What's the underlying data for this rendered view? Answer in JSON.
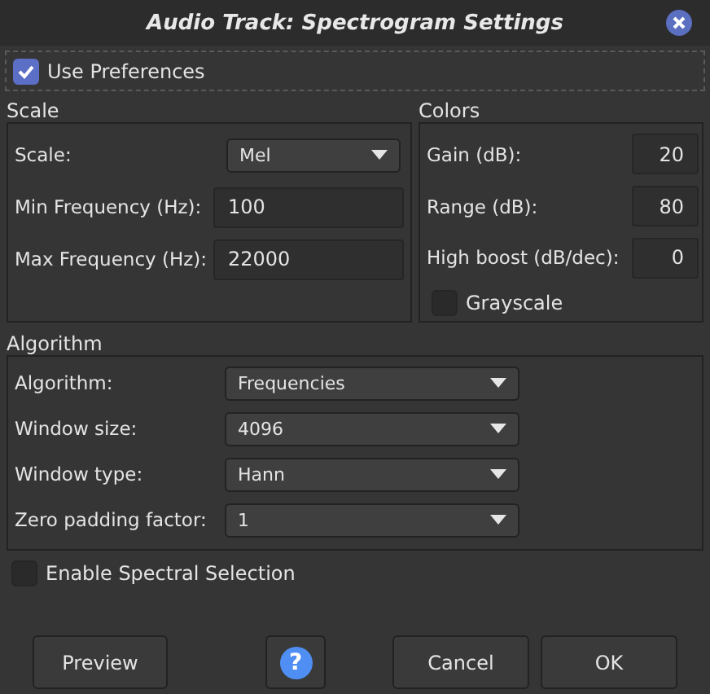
{
  "window": {
    "title": "Audio Track: Spectrogram Settings"
  },
  "use_preferences": {
    "label": "Use Preferences",
    "checked": true
  },
  "scale": {
    "title": "Scale",
    "rows": [
      {
        "label": "Scale:",
        "kind": "dropdown",
        "value": "Mel"
      },
      {
        "label": "Min Frequency (Hz):",
        "kind": "field",
        "value": "100"
      },
      {
        "label": "Max Frequency (Hz):",
        "kind": "field",
        "value": "22000"
      }
    ]
  },
  "colors": {
    "title": "Colors",
    "rows": [
      {
        "label": "Gain (dB):",
        "kind": "field",
        "value": "20"
      },
      {
        "label": "Range (dB):",
        "kind": "field",
        "value": "80"
      },
      {
        "label": "High boost (dB/dec):",
        "kind": "field",
        "value": "0"
      }
    ],
    "grayscale": {
      "label": "Grayscale",
      "checked": false
    }
  },
  "algorithm": {
    "title": "Algorithm",
    "rows": [
      {
        "label": "Algorithm:",
        "kind": "dropdown",
        "value": "Frequencies"
      },
      {
        "label": "Window size:",
        "kind": "dropdown",
        "value": "4096"
      },
      {
        "label": "Window type:",
        "kind": "dropdown",
        "value": "Hann"
      },
      {
        "label": "Zero padding factor:",
        "kind": "dropdown",
        "value": "1"
      }
    ]
  },
  "spectral_selection": {
    "label": "Enable Spectral Selection",
    "checked": false
  },
  "buttons": [
    {
      "kind": "text",
      "label": "Preview"
    },
    {
      "kind": "help",
      "label": "?"
    },
    {
      "kind": "text",
      "label": "Cancel"
    },
    {
      "kind": "text",
      "label": "OK"
    }
  ]
}
